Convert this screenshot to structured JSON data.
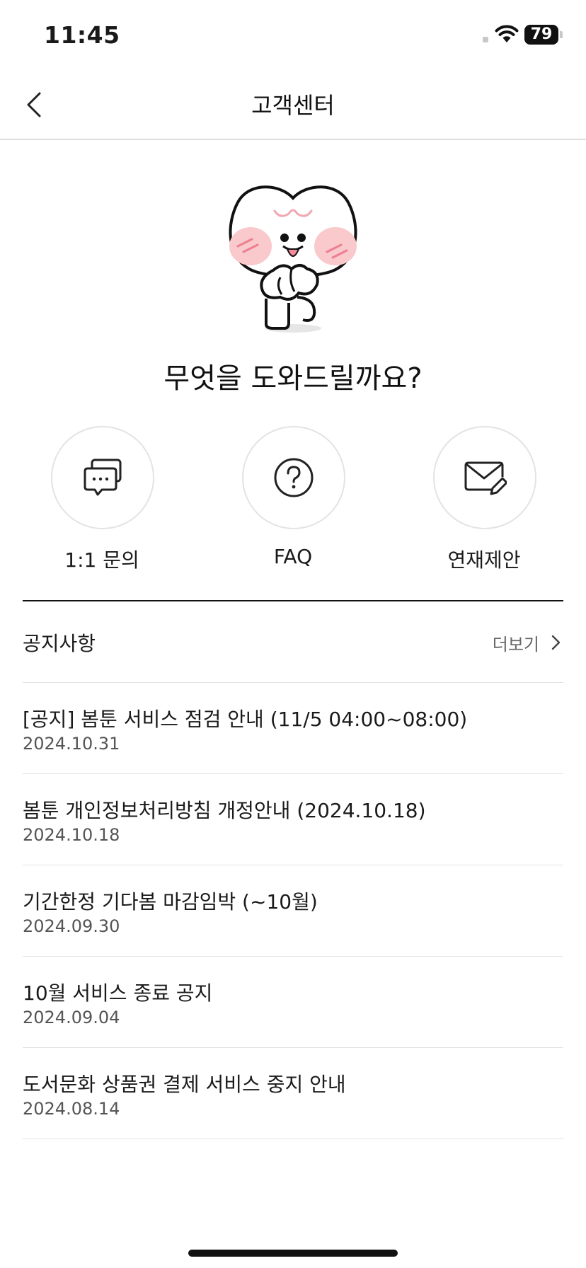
{
  "status_bar": {
    "time": "11:45",
    "battery": "79"
  },
  "header": {
    "title": "고객센터"
  },
  "hero": {
    "heading": "무엇을 도와드릴까요?"
  },
  "actions": [
    {
      "label": "1:1 문의",
      "icon": "chat-bubbles-icon"
    },
    {
      "label": "FAQ",
      "icon": "question-circle-icon"
    },
    {
      "label": "연재제안",
      "icon": "envelope-edit-icon"
    }
  ],
  "notices": {
    "title": "공지사항",
    "more_label": "더보기",
    "items": [
      {
        "title": "[공지] 봄툰 서비스 점검 안내 (11/5 04:00~08:00)",
        "date": "2024.10.31"
      },
      {
        "title": "봄툰 개인정보처리방침 개정안내 (2024.10.18)",
        "date": "2024.10.18"
      },
      {
        "title": "기간한정 기다봄 마감임박 (~10월)",
        "date": "2024.09.30"
      },
      {
        "title": "10월 서비스 종료 공지",
        "date": "2024.09.04"
      },
      {
        "title": "도서문화 상품권 결제 서비스 중지 안내",
        "date": "2024.08.14"
      }
    ]
  },
  "colors": {
    "text": "#1a1a1a",
    "divider": "#e2e2e2",
    "cheek": "#f9c9cc"
  }
}
